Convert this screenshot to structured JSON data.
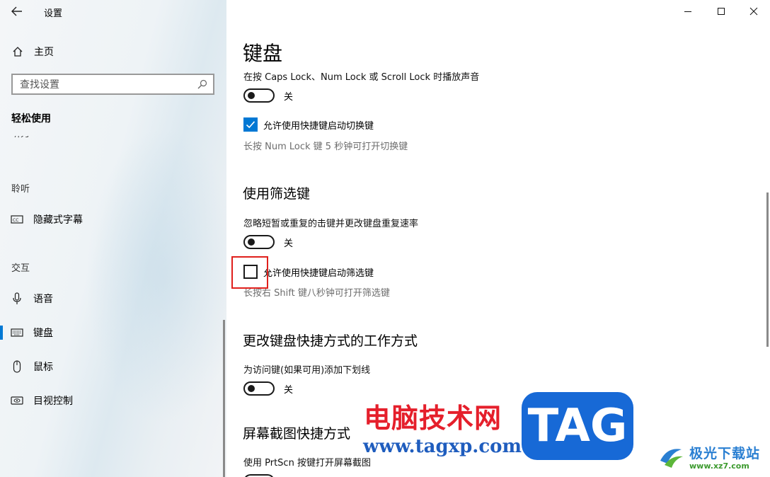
{
  "window": {
    "title": "设置",
    "minimize_icon": "minimize-icon",
    "maximize_icon": "maximize-icon",
    "close_icon": "close-icon"
  },
  "sidebar": {
    "home_label": "主页",
    "search_placeholder": "查找设置",
    "section_title": "轻松使用",
    "cut_item": "听力",
    "groups": {
      "hearing": "聆听",
      "interaction": "交互"
    },
    "items": [
      {
        "label": "隐藏式字幕",
        "icon": "closed-captions-icon"
      },
      {
        "label": "语音",
        "icon": "microphone-icon"
      },
      {
        "label": "键盘",
        "icon": "keyboard-icon",
        "selected": true
      },
      {
        "label": "鼠标",
        "icon": "mouse-icon"
      },
      {
        "label": "目视控制",
        "icon": "eye-control-icon"
      }
    ]
  },
  "main": {
    "title": "键盘",
    "toggle_keys": {
      "desc": "在按 Caps Lock、Num Lock 或 Scroll Lock 时播放声音",
      "toggle_state": "关",
      "checkbox_label": "允许使用快捷键启动切换键",
      "checkbox_checked": true,
      "hint": "长按 Num Lock 键 5 秒钟可打开切换键"
    },
    "filter_keys": {
      "heading": "使用筛选键",
      "desc": "忽略短暂或重复的击键并更改键盘重复速率",
      "toggle_state": "关",
      "checkbox_label": "允许使用快捷键启动筛选键",
      "checkbox_checked": false,
      "hint": "长按右 Shift 键八秒钟可打开筛选键"
    },
    "shortcuts": {
      "heading": "更改键盘快捷方式的工作方式",
      "desc": "为访问键(如果可用)添加下划线",
      "toggle_state": "关"
    },
    "print_screen": {
      "heading": "屏幕截图快捷方式",
      "desc": "使用 PrtScn 按键打开屏幕截图"
    }
  },
  "watermark": {
    "site_cn": "电脑技术网",
    "site_url": "www.tagxp.com",
    "tag": "TAG",
    "logo_text": "极光下载站",
    "logo_url": "www.xz7.com"
  },
  "colors": {
    "accent": "#0078d4",
    "highlight_box": "#e0201c",
    "watermark_red": "#e51f2b",
    "watermark_blue": "#1769d6"
  }
}
